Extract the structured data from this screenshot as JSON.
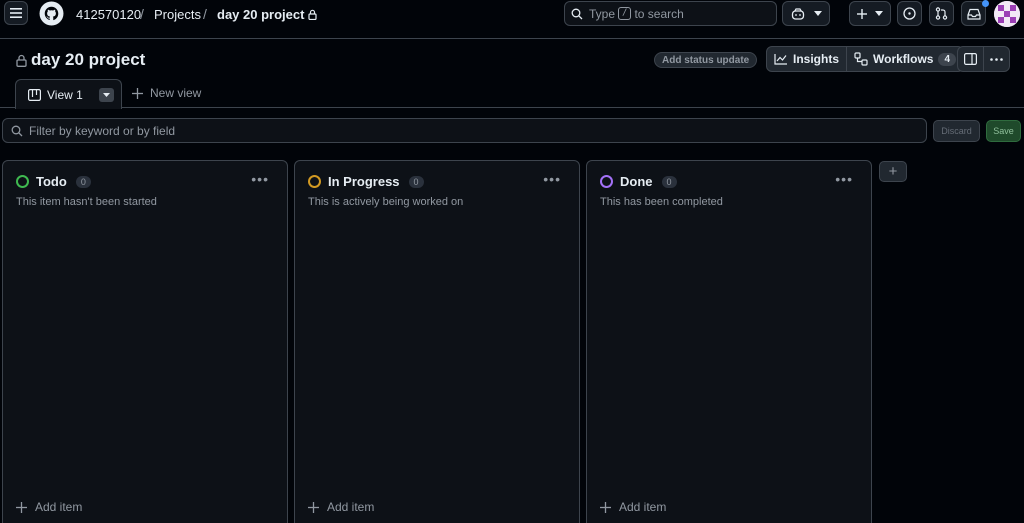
{
  "header": {
    "breadcrumbs": [
      "412570120",
      "Projects",
      "day 20 project"
    ],
    "separator": "/",
    "search": {
      "prefix": "Type",
      "key": "/",
      "suffix": "to search"
    }
  },
  "project": {
    "title": "day 20 project",
    "status_button": "Add status update",
    "insights_label": "Insights",
    "workflows_label": "Workflows",
    "workflows_count": "4"
  },
  "tabs": {
    "active": "View 1",
    "new_view": "New view"
  },
  "filter": {
    "placeholder": "Filter by keyword or by field",
    "discard_label": "Discard",
    "save_label": "Save"
  },
  "columns": [
    {
      "name": "Todo",
      "count": "0",
      "description": "This item hasn't been started",
      "color": "#3fb950",
      "add_label": "Add item"
    },
    {
      "name": "In Progress",
      "count": "0",
      "description": "This is actively being worked on",
      "color": "#d29922",
      "add_label": "Add item"
    },
    {
      "name": "Done",
      "count": "0",
      "description": "This has been completed",
      "color": "#a371f7",
      "add_label": "Add item"
    }
  ],
  "add_column_label": "+"
}
